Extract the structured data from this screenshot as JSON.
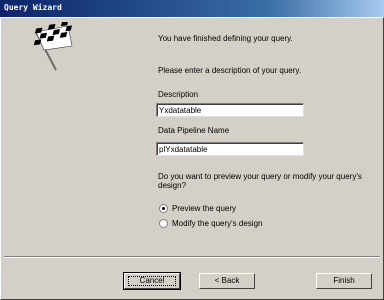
{
  "window": {
    "title": "Query Wizard"
  },
  "intro": {
    "finished": "You have finished defining your query.",
    "enter_description": "Please enter a description of your query."
  },
  "description": {
    "label": "Description",
    "value": "Yxdatatable"
  },
  "pipeline": {
    "label": "Data Pipeline Name",
    "value": "plYxdatatable"
  },
  "preview_question": {
    "line1": "Do you want to preview your query or modify your query's",
    "line2": "design?"
  },
  "options": [
    {
      "label": "Preview the query",
      "selected": true
    },
    {
      "label": "Modify the query's design",
      "selected": false
    }
  ],
  "buttons": {
    "cancel": "Cancel",
    "back": "< Back",
    "finish": "Finish"
  }
}
